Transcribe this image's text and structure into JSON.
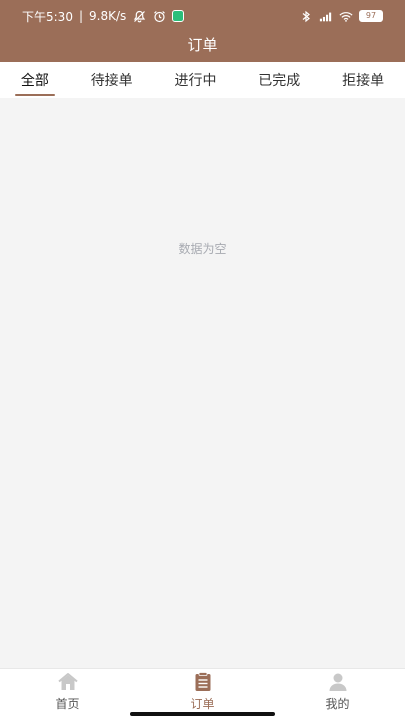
{
  "status_bar": {
    "time": "下午5:30",
    "network_speed": "9.8K/s",
    "battery": "97"
  },
  "header": {
    "title": "订单"
  },
  "tabs": [
    {
      "label": "全部",
      "active": true
    },
    {
      "label": "待接单",
      "active": false
    },
    {
      "label": "进行中",
      "active": false
    },
    {
      "label": "已完成",
      "active": false
    },
    {
      "label": "拒接单",
      "active": false
    }
  ],
  "content": {
    "empty_text": "数据为空"
  },
  "bottom_nav": [
    {
      "label": "首页",
      "icon": "home-icon",
      "active": false
    },
    {
      "label": "订单",
      "icon": "order-list-icon",
      "active": true
    },
    {
      "label": "我的",
      "icon": "profile-icon",
      "active": false
    }
  ],
  "colors": {
    "brand": "#9b6e58",
    "background": "#f4f4f4",
    "muted_text": "#a7aab1",
    "inactive_icon": "#c8c8c8"
  }
}
